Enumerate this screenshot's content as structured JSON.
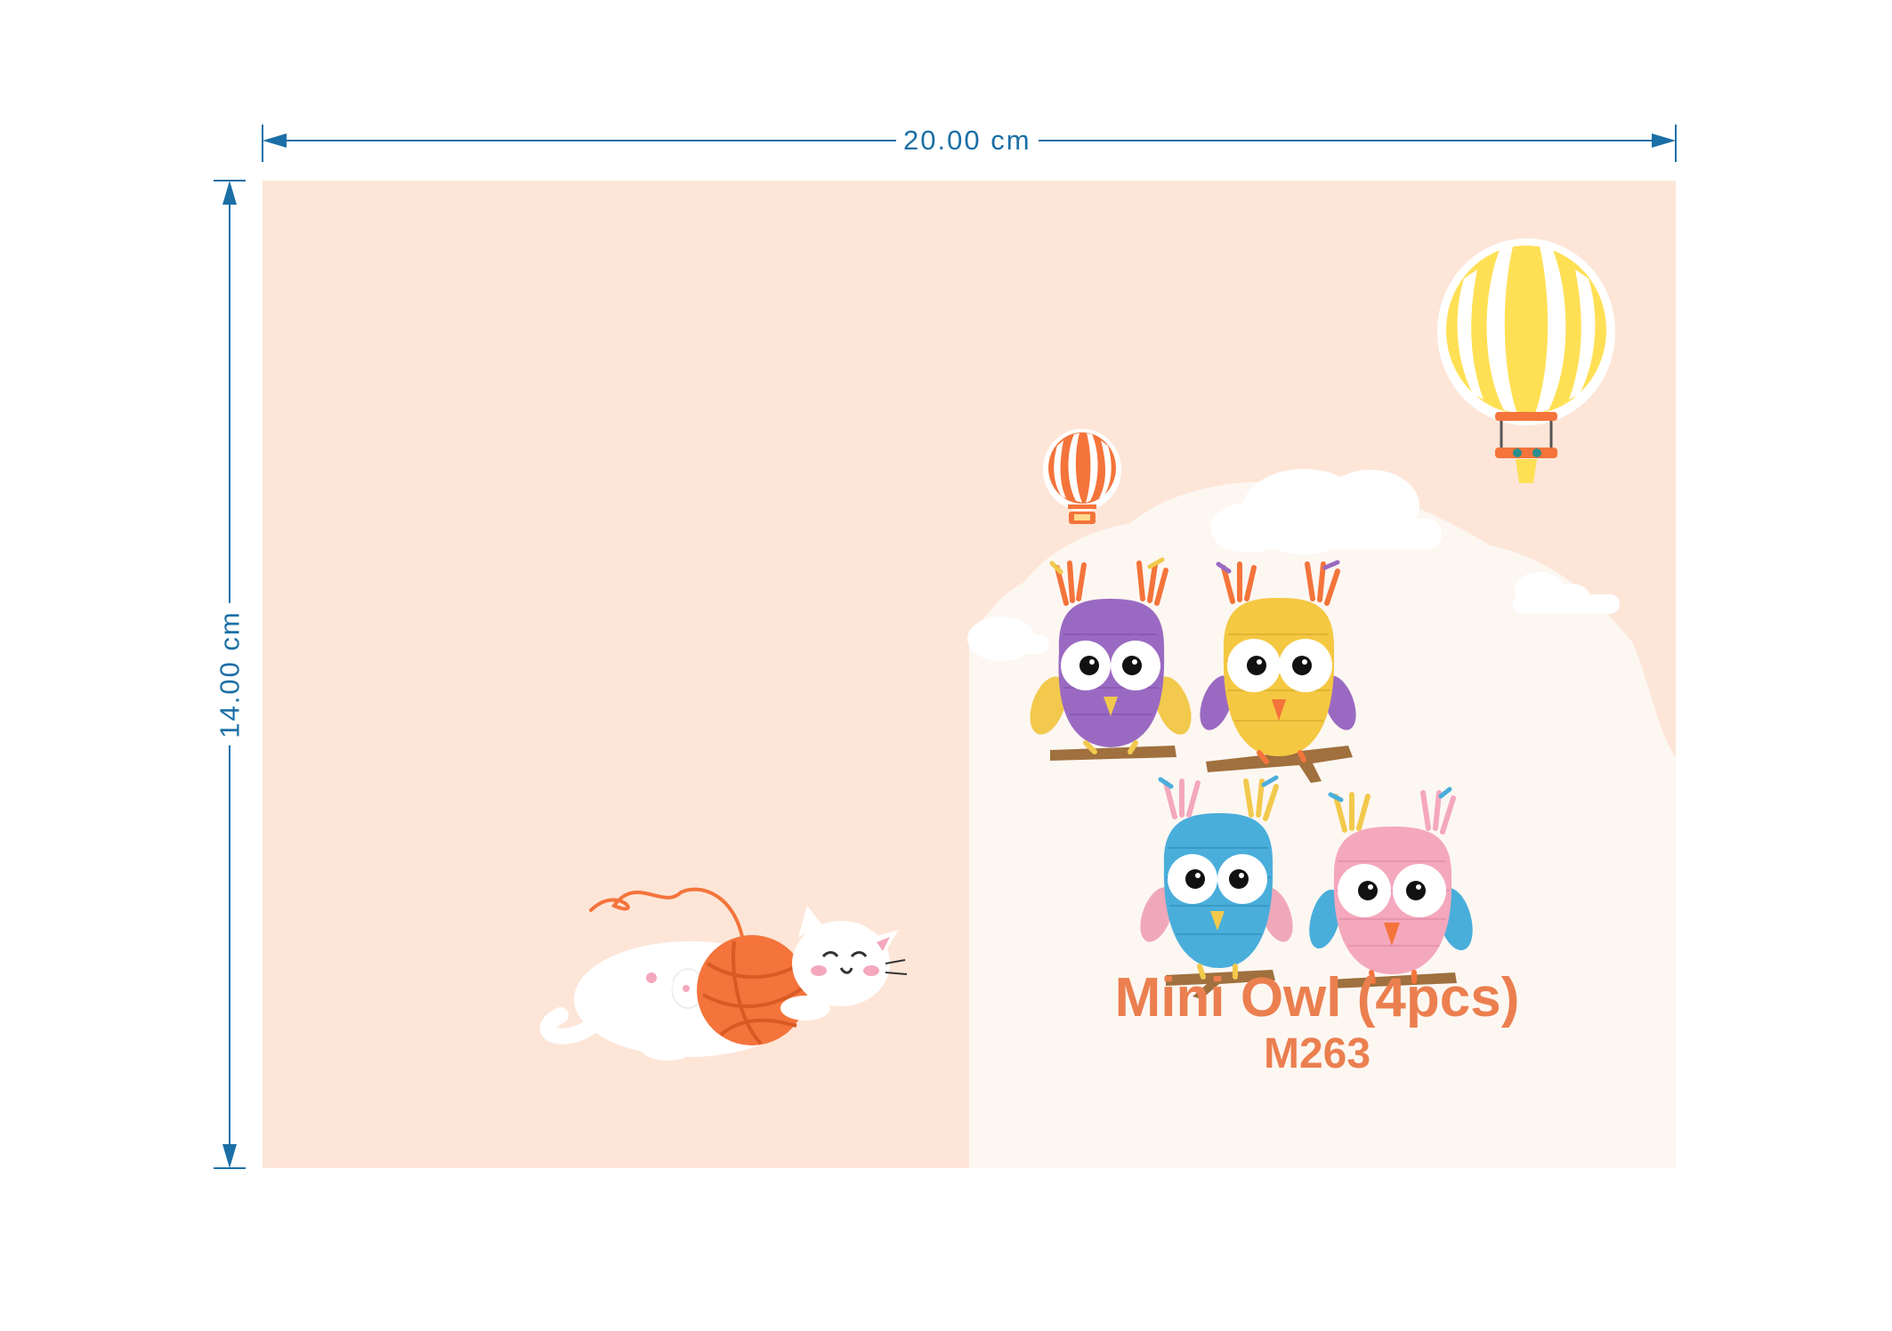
{
  "dimensions": {
    "width_label": "20.00 cm",
    "height_label": "14.00 cm",
    "line_color": "#1b6fa6"
  },
  "card": {
    "background": "#fde6d8",
    "panel_background": "#fdf7f2",
    "title": "Mini Owl (4pcs)",
    "code": "M263",
    "title_color": "#eb7f4f"
  },
  "illustrations": {
    "owls": [
      {
        "name": "purple-owl",
        "body": "#9a6ac2",
        "accent": "#f2c94c"
      },
      {
        "name": "yellow-owl",
        "body": "#f5c842",
        "accent": "#9a6ac2"
      },
      {
        "name": "blue-owl",
        "body": "#4aaedb",
        "accent": "#f0a8b8"
      },
      {
        "name": "pink-owl",
        "body": "#f4a8bd",
        "accent": "#4aaedb"
      }
    ],
    "balloons": [
      "yellow-balloon",
      "orange-balloon"
    ],
    "cat": "cat-with-yarn-ball"
  }
}
